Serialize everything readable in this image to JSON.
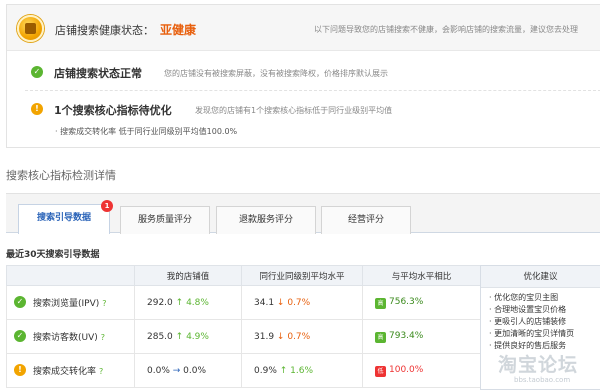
{
  "health": {
    "label": "店铺搜索健康状态：",
    "value": "亚健康",
    "note": "以下问题导致您的店铺搜索不健康，会影响店铺的搜索流量，建议您去处理"
  },
  "status_rows": [
    {
      "title": "店铺搜索状态正常",
      "desc": "您的店铺没有被搜索屏蔽，没有被搜索降权，价格排序默认展示",
      "icon": "check-icon"
    },
    {
      "title": "1个搜索核心指标待优化",
      "desc": "发现您的店铺有1个搜索核心指标低于同行业级别平均值",
      "icon": "warning-icon"
    }
  ],
  "warn_detail": {
    "prefix": "· 搜索成交转化率",
    "text": "低于同行业同级别平均值",
    "value": "100.0%"
  },
  "section_title": "搜索核心指标检测详情",
  "tabs": [
    {
      "label": "搜索引导数据",
      "badge": "1"
    },
    {
      "label": "服务质量评分"
    },
    {
      "label": "退款服务评分"
    },
    {
      "label": "经营评分"
    }
  ],
  "table": {
    "title": "最近30天搜索引导数据",
    "headers": [
      "",
      "我的店铺值",
      "同行业同级别平均水平",
      "与平均水平相比"
    ],
    "rows": [
      {
        "metric": "搜索浏览量(IPV)",
        "q": "?",
        "mine": "292.0",
        "mine_arrow": "↑",
        "mine_change": "4.8%",
        "avg": "34.1",
        "avg_arrow": "↓",
        "avg_change": "0.7%",
        "cmp_icon": "高",
        "cmp": "756.3%",
        "status": "good"
      },
      {
        "metric": "搜索访客数(UV)",
        "q": "?",
        "mine": "285.0",
        "mine_arrow": "↑",
        "mine_change": "4.9%",
        "avg": "31.9",
        "avg_arrow": "↓",
        "avg_change": "0.7%",
        "cmp_icon": "高",
        "cmp": "793.4%",
        "status": "good"
      },
      {
        "metric": "搜索成交转化率",
        "q": "?",
        "mine": "0.0%",
        "mine_arrow": "→",
        "mine_change": "0.0%",
        "avg": "0.9%",
        "avg_arrow": "↑",
        "avg_change": "1.6%",
        "cmp_icon": "低",
        "cmp": "100.0%",
        "status": "warn"
      }
    ]
  },
  "suggestions": {
    "title": "优化建议",
    "items": [
      "· 优化您的宝贝主图",
      "· 合理地设置宝贝价格",
      "· 更吸引人的店铺装修",
      "· 更加清晰的宝贝详情页",
      "· 提供良好的售后服务"
    ]
  },
  "watermark": {
    "main": "淘宝论坛",
    "sub": "bbs.taobao.com"
  },
  "colors": {
    "accent": "#e8600e",
    "good": "#5bb531",
    "bad": "#e33333",
    "link": "#2a63b8"
  }
}
